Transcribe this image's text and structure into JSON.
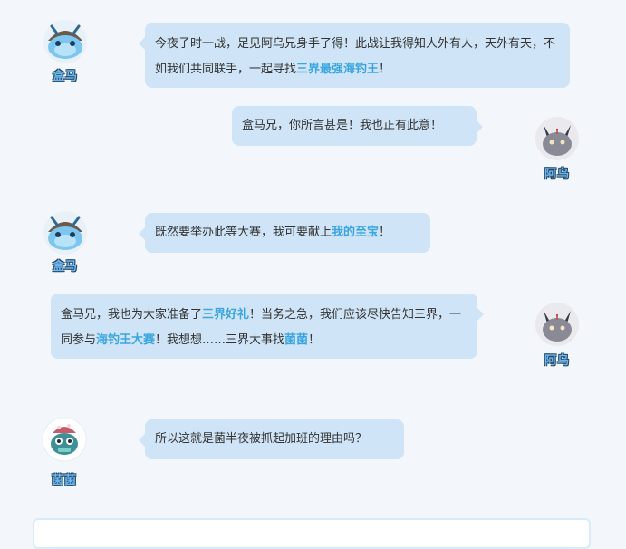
{
  "characters": {
    "hema": "盒马",
    "awu": "阿乌",
    "junjun": "菌菌"
  },
  "messages": [
    {
      "speaker": "盒马",
      "parts": [
        "今夜子时一战，足见阿乌兄身手了得！此战让我得知人外有人，天外有天，不如我们共同联手，一起寻找",
        "三界最强海钓王",
        "！"
      ]
    },
    {
      "speaker": "阿乌",
      "parts": [
        "盒马兄，你所言甚是！我也正有此意！"
      ]
    },
    {
      "speaker": "盒马",
      "parts": [
        "既然要举办此等大赛，我可要献上",
        "我的至宝",
        "！"
      ]
    },
    {
      "speaker": "阿乌",
      "parts": [
        "盒马兄，我也为大家准备了",
        "三界好礼",
        "！当务之急，我们应该尽快告知三界，一同参与",
        "海钓王大赛",
        "！我想想……三界大事找",
        "菌菌",
        "！"
      ]
    },
    {
      "speaker": "菌菌",
      "parts": [
        "所以这就是菌半夜被抓起加班的理由吗？"
      ]
    }
  ],
  "colors": {
    "bubble": "#cfe4f6",
    "highlight": "#3aa5e0",
    "name_fill": "#6fb6e8",
    "name_outline": "#23466b",
    "background": "#f3f6fb"
  }
}
